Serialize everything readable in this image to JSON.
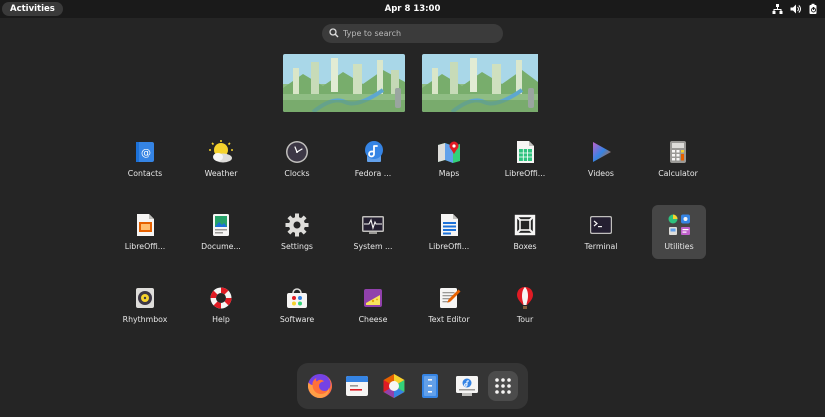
{
  "topbar": {
    "activities_label": "Activities",
    "clock": "Apr 8  13:00",
    "tray_icons": [
      "network-icon",
      "volume-icon",
      "power-icon"
    ]
  },
  "search": {
    "placeholder": "Type to search"
  },
  "workspaces": [
    "workspace-1",
    "workspace-2"
  ],
  "apps": {
    "contacts": "Contacts",
    "weather": "Weather",
    "clocks": "Clocks",
    "fedora": "Fedora ...",
    "maps": "Maps",
    "libreoffice_calc": "LibreOffi...",
    "videos": "Videos",
    "calculator": "Calculator",
    "libreoffice_impress": "LibreOffi...",
    "document_viewer": "Docume...",
    "settings": "Settings",
    "system_monitor": "System ...",
    "libreoffice_writer": "LibreOffi...",
    "boxes": "Boxes",
    "terminal": "Terminal",
    "utilities": "Utilities",
    "rhythmbox": "Rhythmbox",
    "help": "Help",
    "software": "Software",
    "cheese": "Cheese",
    "text_editor": "Text Editor",
    "tour": "Tour"
  },
  "dash": [
    "firefox-icon",
    "calendar-icon",
    "software-icon",
    "files-icon",
    "installer-icon",
    "show-apps-icon"
  ],
  "colors": {
    "background": "#252525",
    "topbar": "#1a1a1a",
    "dash": "#353535",
    "folder": "#464646"
  }
}
